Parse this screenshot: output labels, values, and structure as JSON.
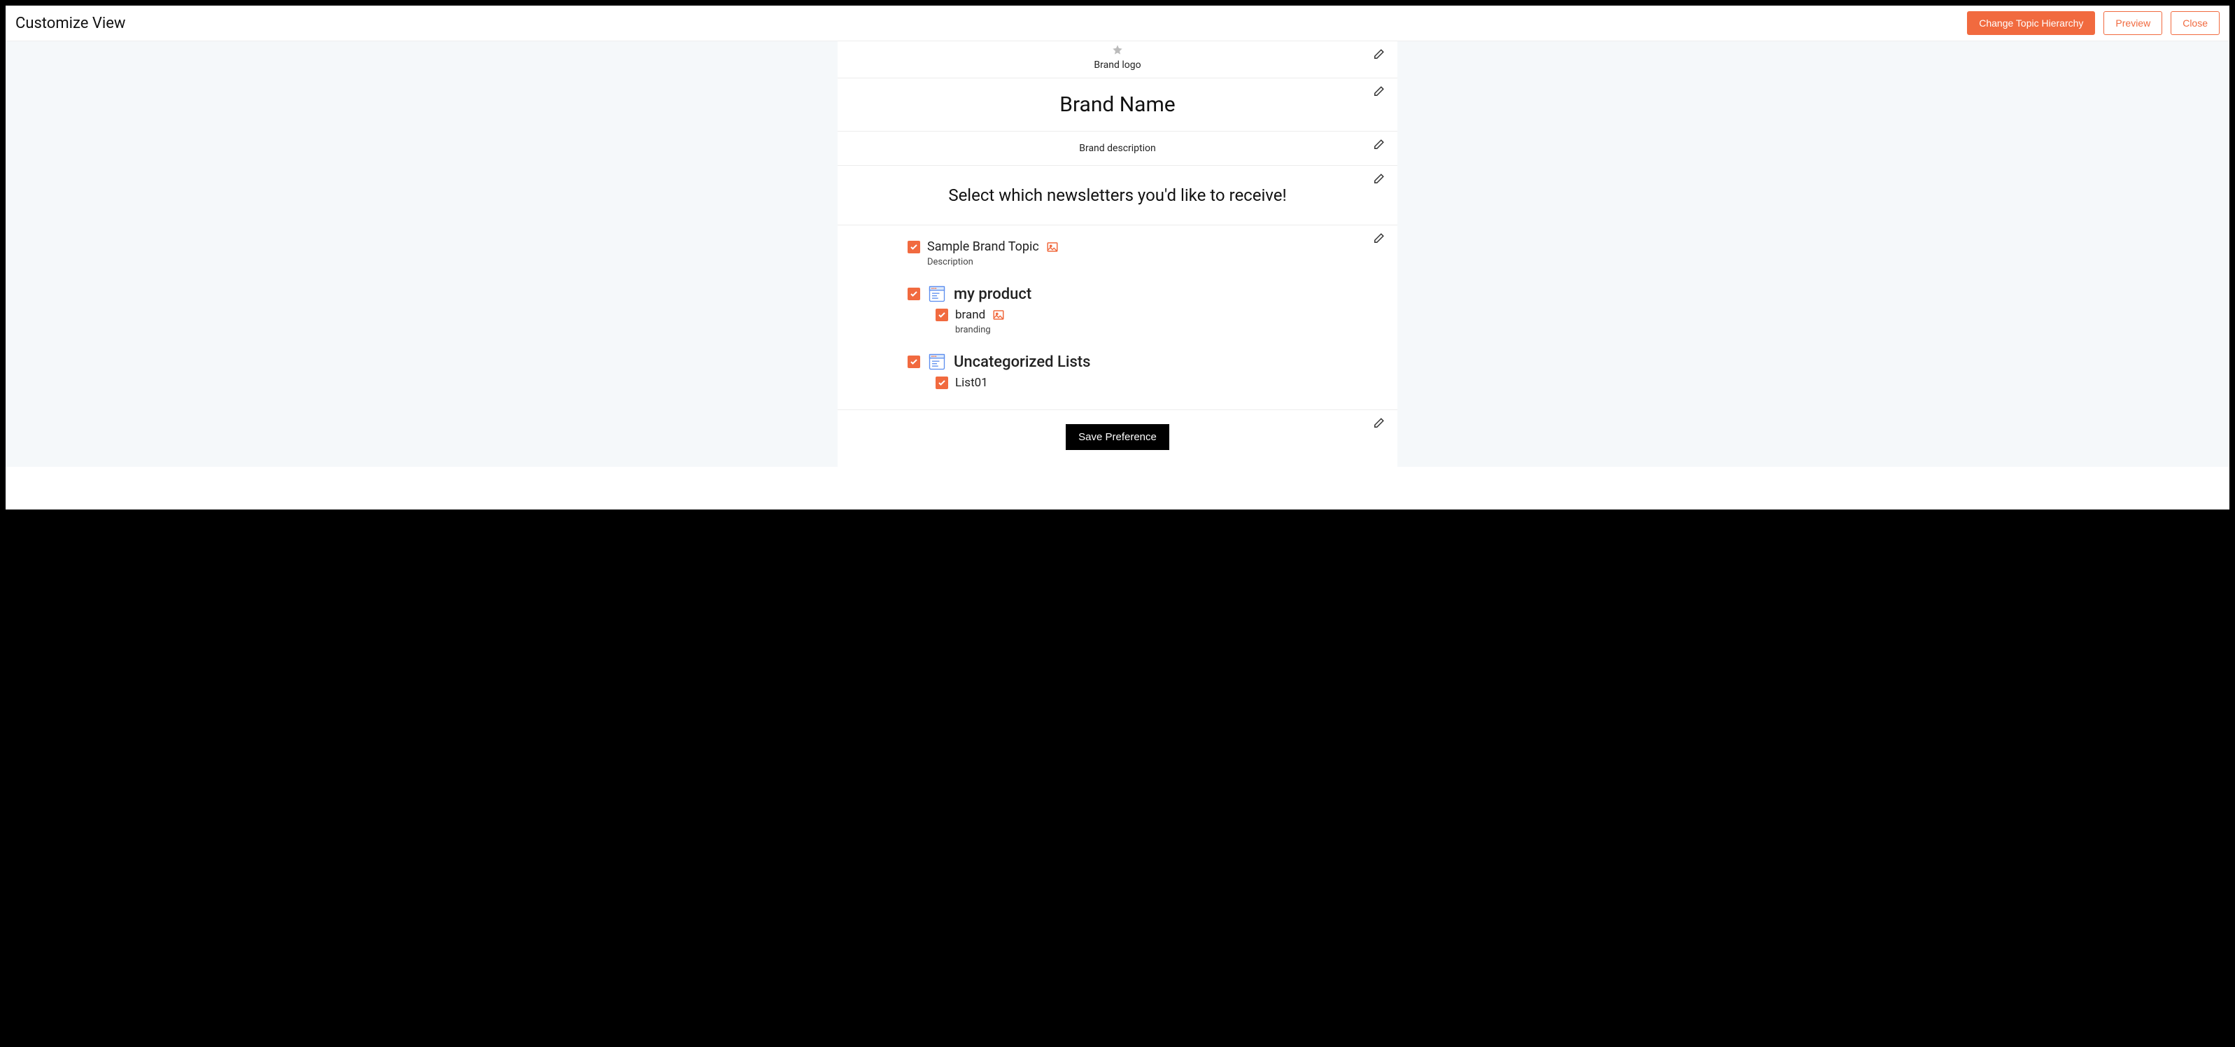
{
  "header": {
    "title": "Customize View",
    "actions": {
      "change_hierarchy": "Change Topic Hierarchy",
      "preview": "Preview",
      "close": "Close"
    }
  },
  "brand": {
    "logo_label": "Brand logo",
    "name": "Brand Name",
    "description": "Brand description"
  },
  "newsletter": {
    "heading": "Select which newsletters you'd like to receive!"
  },
  "topics": [
    {
      "label": "Sample Brand Topic",
      "description": "Description",
      "checked": true,
      "has_image_icon": true,
      "type": "topic",
      "children": []
    },
    {
      "label": "my product",
      "checked": true,
      "has_window_icon": true,
      "type": "category",
      "children": [
        {
          "label": "brand",
          "description": "branding",
          "checked": true,
          "has_image_icon": true
        }
      ]
    },
    {
      "label": "Uncategorized Lists",
      "checked": true,
      "has_window_icon": true,
      "type": "category",
      "children": [
        {
          "label": "List01",
          "checked": true
        }
      ]
    }
  ],
  "save": {
    "label": "Save Preference"
  }
}
